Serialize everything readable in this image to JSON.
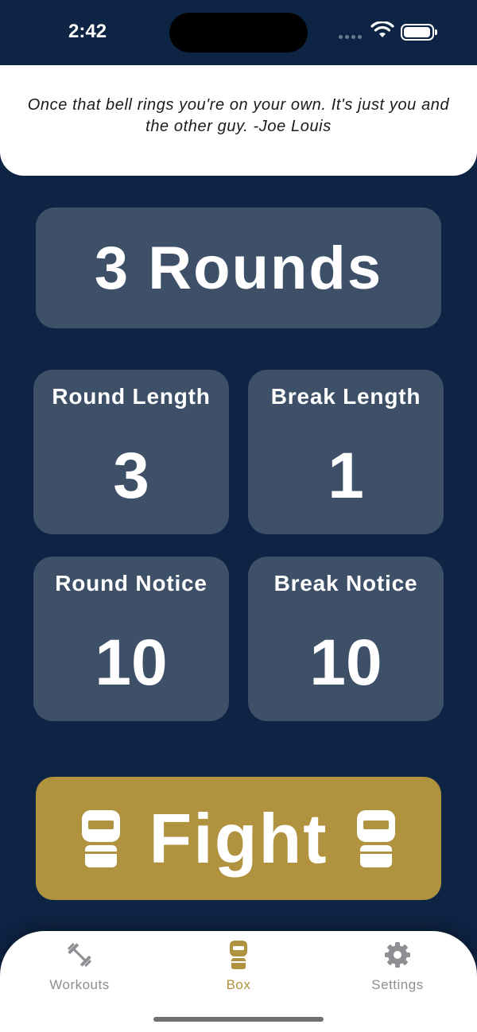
{
  "status_bar": {
    "time": "2:42"
  },
  "quote": {
    "text": "Once that bell rings you're on your own. It's just you and the other guy. -Joe Louis"
  },
  "rounds": {
    "label": "3 Rounds"
  },
  "settings_tiles": [
    {
      "label": "Round Length",
      "value": "3"
    },
    {
      "label": "Break Length",
      "value": "1"
    },
    {
      "label": "Round Notice",
      "value": "10"
    },
    {
      "label": "Break Notice",
      "value": "10"
    }
  ],
  "fight_button": {
    "label": "Fight",
    "icon": "boxing-glove-icon"
  },
  "tab_bar": {
    "items": [
      {
        "label": "Workouts",
        "icon": "dumbbell-icon",
        "active": false
      },
      {
        "label": "Box",
        "icon": "boxing-glove-icon",
        "active": true
      },
      {
        "label": "Settings",
        "icon": "gear-icon",
        "active": false
      }
    ]
  },
  "colors": {
    "background": "#0e2445",
    "card": "#3d5068",
    "accent": "#b0923f",
    "inactive_tab": "#8e8e93"
  }
}
